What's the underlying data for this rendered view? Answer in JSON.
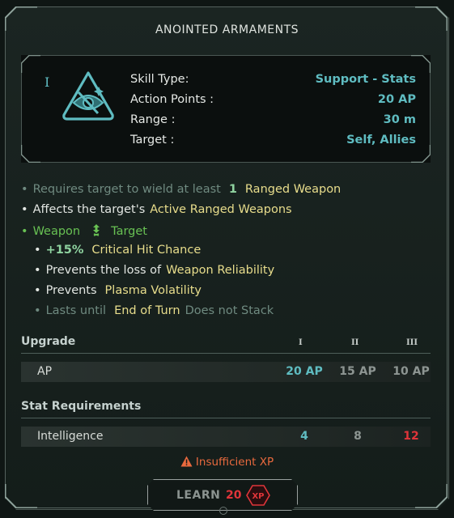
{
  "title": "ANOINTED ARMAMENTS",
  "skill": {
    "rank": "I",
    "icon": "skill-eye-icon",
    "rows": [
      {
        "label": "Skill Type:",
        "value": "Support - Stats"
      },
      {
        "label": "Action Points :",
        "value": "20 AP"
      },
      {
        "label": "Range :",
        "value": "30 m"
      },
      {
        "label": "Target :",
        "value": "Self, Allies"
      }
    ]
  },
  "description": {
    "requires": {
      "prefix": "Requires target to wield at least",
      "count": "1",
      "item": "Ranged Weapon"
    },
    "affects": {
      "prefix": "Affects the target's",
      "item": "Active Ranged Weapons"
    },
    "weapon_line": {
      "left": "Weapon",
      "icon": "buff-arrow-icon",
      "right": "Target"
    },
    "crit": {
      "value": "+15%",
      "text": "Critical Hit Chance"
    },
    "reliability": {
      "prefix": "Prevents the loss of",
      "item": "Weapon Reliability"
    },
    "plasma": {
      "prefix": "Prevents",
      "item": "Plasma Volatility"
    },
    "duration": {
      "prefix": "Lasts until",
      "item": "End of Turn",
      "suffix": "Does not Stack"
    }
  },
  "upgrade": {
    "header": "Upgrade",
    "levels": [
      "I",
      "II",
      "III"
    ],
    "row": {
      "label": "AP",
      "values": [
        "20 AP",
        "15 AP",
        "10 AP"
      ]
    }
  },
  "stat_requirements": {
    "header": "Stat Requirements",
    "row": {
      "label": "Intelligence",
      "values": [
        "4",
        "8",
        "12"
      ]
    }
  },
  "warning": {
    "icon": "warning-triangle-icon",
    "text": "Insufficient XP"
  },
  "learn": {
    "label": "LEARN",
    "cost": "20",
    "badge": "XP"
  },
  "colors": {
    "teal": "#5fbcc1",
    "yellow": "#e8dd8c",
    "green": "#68c153",
    "red": "#e0353a",
    "orange": "#e96a3e"
  }
}
